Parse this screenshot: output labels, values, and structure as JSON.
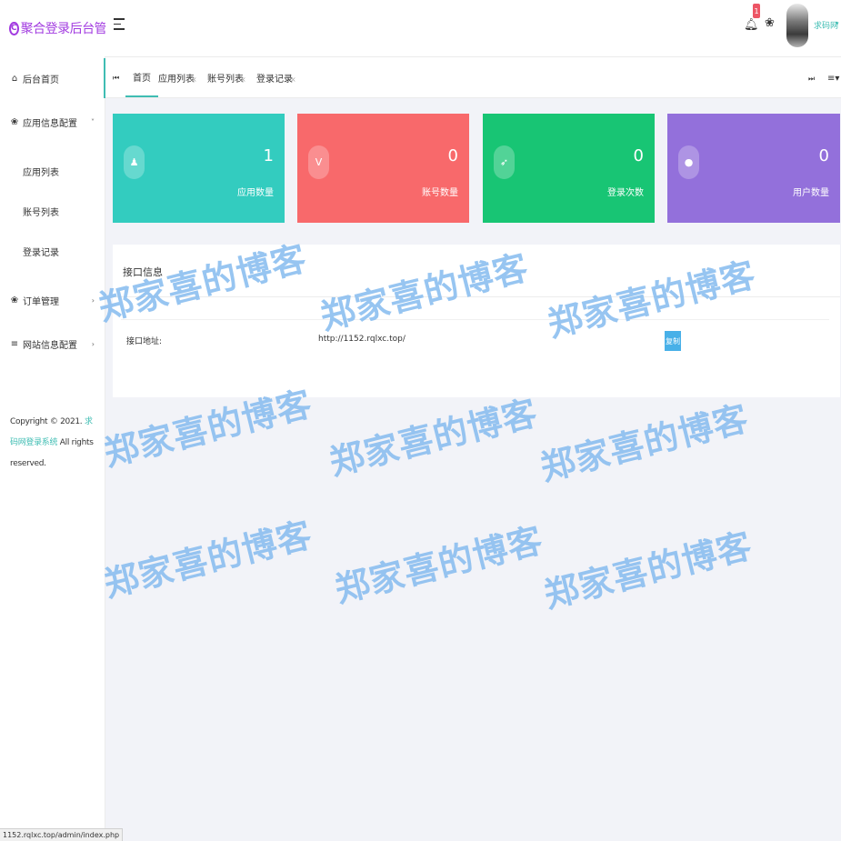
{
  "app": {
    "title": "聚合登录后台管理",
    "logo_icon": "C"
  },
  "colors": {
    "accent": "#3fbdb3",
    "brand": "#a23be0",
    "watermark": "#80b8ee"
  },
  "sidebar": {
    "items": [
      {
        "label": "后台首页",
        "icon": "home-icon",
        "glyph": "⌂"
      },
      {
        "label": "应用信息配置",
        "icon": "palette-icon",
        "glyph": "❀",
        "arrow": "˅",
        "children": [
          "应用列表",
          "账号列表",
          "登录记录"
        ]
      },
      {
        "label": "订单管理",
        "icon": "palette-icon",
        "glyph": "❀",
        "arrow": "›"
      },
      {
        "label": "网站信息配置",
        "icon": "list-icon",
        "glyph": "≡",
        "arrow": "›"
      }
    ],
    "copyright_prefix": "Copyright © 2021. ",
    "copyright_link": "求码网登录系统",
    "copyright_suffix": " All rights reserved."
  },
  "header": {
    "notification_count": "1",
    "username": "求码网",
    "caret": "▾"
  },
  "tabs": [
    {
      "label": "首页"
    },
    {
      "label": "应用列表",
      "close": "×"
    },
    {
      "label": "账号列表",
      "close": "×"
    },
    {
      "label": "登录记录",
      "close": "×"
    }
  ],
  "stats": [
    {
      "value": "1",
      "label": "应用数量",
      "icon": "android-icon",
      "glyph": "♟",
      "color": "#33ccbf"
    },
    {
      "value": "0",
      "label": "账号数量",
      "icon": "vue-icon",
      "glyph": "V",
      "color": "#f8696b"
    },
    {
      "value": "0",
      "label": "登录次数",
      "icon": "rocket-icon",
      "glyph": "➶",
      "color": "#18c574"
    },
    {
      "value": "0",
      "label": "用户数量",
      "icon": "user-icon",
      "glyph": "●",
      "color": "#9370db"
    }
  ],
  "panel": {
    "title": "接口信息",
    "api_label": "接口地址:",
    "api_url": "http://1152.rqlxc.top/",
    "copy_label": "复制"
  },
  "status_bar": {
    "url": "1152.rqlxc.top/admin/index.php"
  },
  "watermark": {
    "text": "郑家喜的博客"
  }
}
